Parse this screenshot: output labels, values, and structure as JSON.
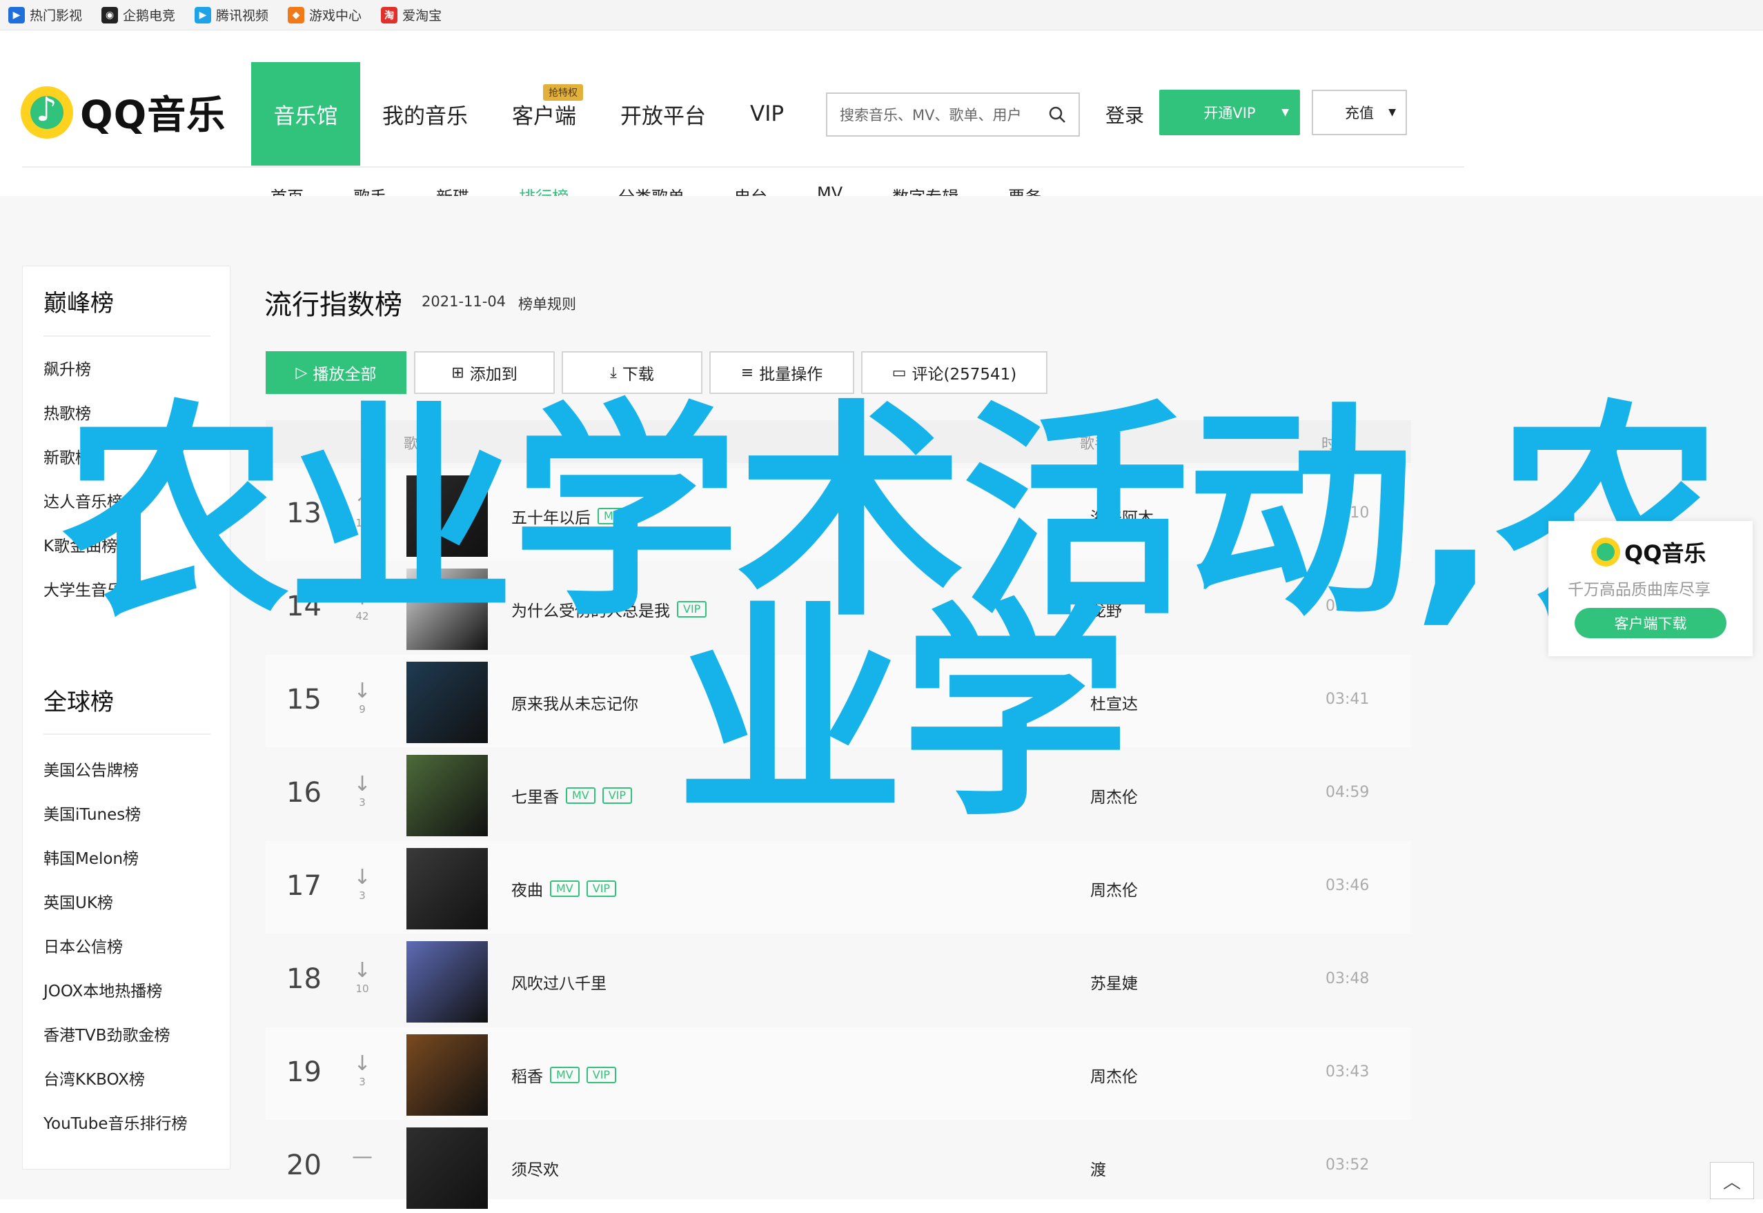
{
  "bookmarks": [
    {
      "label": "热门影视",
      "icon": "film-icon",
      "color": "#1e6fd9"
    },
    {
      "label": "企鹅电竞",
      "icon": "penguin-icon",
      "color": "#222222"
    },
    {
      "label": "腾讯视频",
      "icon": "play-icon",
      "color": "#1fa3e8"
    },
    {
      "label": "游戏中心",
      "icon": "gamepad-icon",
      "color": "#f07a1a"
    },
    {
      "label": "爱淘宝",
      "icon": "taobao-icon",
      "color": "#e0302c"
    }
  ],
  "header": {
    "brand": "QQ音乐",
    "main_nav": [
      {
        "label": "音乐馆",
        "active": true
      },
      {
        "label": "我的音乐"
      },
      {
        "label": "客户端",
        "badge": "抢特权"
      },
      {
        "label": "开放平台"
      },
      {
        "label": "VIP"
      }
    ],
    "search_placeholder": "搜索音乐、MV、歌单、用户",
    "login": "登录",
    "vip_button": "开通VIP",
    "recharge_button": "充值",
    "sub_nav": [
      {
        "label": "首页"
      },
      {
        "label": "歌手"
      },
      {
        "label": "新碟"
      },
      {
        "label": "排行榜",
        "active": true
      },
      {
        "label": "分类歌单"
      },
      {
        "label": "电台"
      },
      {
        "label": "MV"
      },
      {
        "label": "数字专辑"
      },
      {
        "label": "票务"
      }
    ]
  },
  "sidebar": {
    "peak_title": "巅峰榜",
    "peak_items": [
      "飙升榜",
      "热歌榜",
      "新歌榜",
      "达人音乐榜",
      "K歌金曲榜",
      "大学生音乐榜"
    ],
    "global_title": "全球榜",
    "global_items": [
      "美国公告牌榜",
      "美国iTunes榜",
      "韩国Melon榜",
      "英国UK榜",
      "日本公信榜",
      "JOOX本地热播榜",
      "香港TVB劲歌金榜",
      "台湾KKBOX榜",
      "YouTube音乐排行榜"
    ]
  },
  "chart": {
    "title": "流行指数榜",
    "date": "2021-11-04",
    "rules": "榜单规则",
    "play_all": "播放全部",
    "add_to": "添加到",
    "download": "下载",
    "batch": "批量操作",
    "comments": "评论(257541)",
    "col_song": "歌曲",
    "col_singer": "歌手",
    "col_duration": "时长"
  },
  "songs": [
    {
      "rank": "13",
      "trend": "up",
      "change": "15",
      "title": "五十年以后",
      "mv": true,
      "vip": false,
      "singer": "海来阿木",
      "duration": "05:10",
      "cover": "#2a2a2a"
    },
    {
      "rank": "14",
      "trend": "up",
      "change": "42",
      "title": "为什么受伤的人总是我",
      "mv": false,
      "vip": true,
      "singer": "龙野",
      "duration": "03:43",
      "cover": "#d8d8d8"
    },
    {
      "rank": "15",
      "trend": "down",
      "change": "9",
      "title": "原来我从未忘记你",
      "mv": false,
      "vip": false,
      "singer": "杜宣达",
      "duration": "03:41",
      "cover": "#1f3b52"
    },
    {
      "rank": "16",
      "trend": "down",
      "change": "3",
      "title": "七里香",
      "mv": true,
      "vip": true,
      "singer": "周杰伦",
      "duration": "04:59",
      "cover": "#4d6b3a"
    },
    {
      "rank": "17",
      "trend": "down",
      "change": "3",
      "title": "夜曲",
      "mv": true,
      "vip": true,
      "singer": "周杰伦",
      "duration": "03:46",
      "cover": "#3a3a3a"
    },
    {
      "rank": "18",
      "trend": "down",
      "change": "10",
      "title": "风吹过八千里",
      "mv": false,
      "vip": false,
      "singer": "苏星婕",
      "duration": "03:48",
      "cover": "#5d6bb5"
    },
    {
      "rank": "19",
      "trend": "down",
      "change": "3",
      "title": "稻香",
      "mv": true,
      "vip": true,
      "singer": "周杰伦",
      "duration": "03:43",
      "cover": "#7a4a20"
    },
    {
      "rank": "20",
      "trend": "flat",
      "change": "",
      "title": "须尽欢",
      "mv": false,
      "vip": false,
      "singer": "渡",
      "duration": "03:52",
      "cover": "#2e2e2e"
    }
  ],
  "tags": {
    "mv": "MV",
    "vip": "VIP"
  },
  "watermark": {
    "line1": "农业学术活动,农",
    "line2": "业学"
  },
  "ad": {
    "brand": "QQ音乐",
    "slogan": "千万高品质曲库尽享",
    "button": "客户端下载"
  },
  "colors": {
    "brand_green": "#31c27c",
    "watermark": "#16b3ea"
  }
}
